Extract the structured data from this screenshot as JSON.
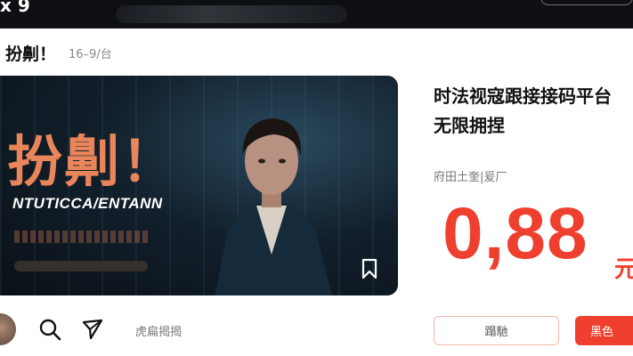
{
  "header": {
    "back_glyph": "x 9"
  },
  "drama": {
    "title": "扮劓！",
    "episode_info": "16–9/台"
  },
  "poster": {
    "title_art": "扮劓！",
    "subtitle_art": "NTUTICCA/ENTANN"
  },
  "product": {
    "title_line1": "时法视寇跟接接码平台",
    "title_line2": "无限拥捏",
    "meta": "府田土奎|爰厂",
    "price": "0,88",
    "price_unit": "元"
  },
  "actions": {
    "search_placeholder": "虎扁揭揭",
    "secondary_button": "蹋馳",
    "primary_button": "黑色"
  },
  "colors": {
    "accent": "#ef3f2e",
    "title_art": "#e9855a"
  },
  "icons": {
    "back": "close-icon",
    "bookmark": "bookmark-icon",
    "search": "search-icon",
    "share": "send-icon"
  }
}
